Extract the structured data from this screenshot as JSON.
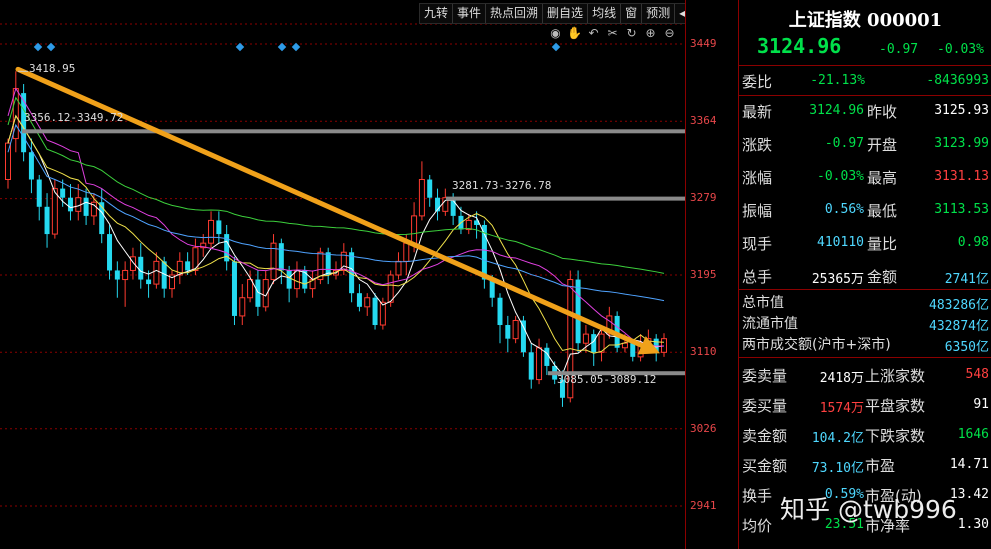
{
  "toolbar": {
    "items": [
      "九转",
      "事件",
      "热点回溯",
      "删自选",
      "均线",
      "窗",
      "预测"
    ],
    "back_icon": "chevron-left-icon"
  },
  "controls": [
    "eye-icon",
    "hand-icon",
    "undo-icon",
    "scissors-icon",
    "refresh-icon",
    "zoom-in-icon",
    "zoom-out-icon"
  ],
  "y_ticks": [
    "3449",
    "3364",
    "3279",
    "3195",
    "3110",
    "3026",
    "2941"
  ],
  "annotations": {
    "high": "3418.95",
    "resist1": "3356.12-3349.72",
    "resist2": "3281.73-3276.78",
    "support": "3085.05-3089.12"
  },
  "chart_data": {
    "type": "candlestick",
    "y_ticks": [
      3449,
      3364,
      3279,
      3195,
      3110,
      3026,
      2941
    ],
    "ylim": [
      2910,
      3480
    ],
    "levels": [
      {
        "label": "3356.12-3349.72",
        "value": 3353
      },
      {
        "label": "3281.73-3276.78",
        "value": 3279
      },
      {
        "label": "3085.05-3089.12",
        "value": 3087
      }
    ],
    "marked_high": 3418.95,
    "trend_line": {
      "from": 3418.95,
      "to": 3110
    },
    "candles": [
      [
        3300,
        3340,
        3290,
        3345
      ],
      [
        3345,
        3400,
        3330,
        3419
      ],
      [
        3395,
        3330,
        3320,
        3405
      ],
      [
        3330,
        3300,
        3285,
        3345
      ],
      [
        3300,
        3270,
        3255,
        3305
      ],
      [
        3270,
        3240,
        3225,
        3285
      ],
      [
        3240,
        3290,
        3235,
        3300
      ],
      [
        3290,
        3280,
        3270,
        3300
      ],
      [
        3280,
        3265,
        3255,
        3295
      ],
      [
        3265,
        3280,
        3255,
        3295
      ],
      [
        3280,
        3260,
        3250,
        3290
      ],
      [
        3260,
        3275,
        3250,
        3285
      ],
      [
        3275,
        3240,
        3230,
        3290
      ],
      [
        3240,
        3200,
        3190,
        3250
      ],
      [
        3200,
        3190,
        3170,
        3210
      ],
      [
        3190,
        3200,
        3160,
        3210
      ],
      [
        3200,
        3215,
        3190,
        3225
      ],
      [
        3215,
        3190,
        3180,
        3230
      ],
      [
        3190,
        3185,
        3170,
        3200
      ],
      [
        3185,
        3210,
        3180,
        3220
      ],
      [
        3210,
        3180,
        3170,
        3215
      ],
      [
        3180,
        3195,
        3170,
        3200
      ],
      [
        3195,
        3210,
        3185,
        3220
      ],
      [
        3210,
        3200,
        3195,
        3220
      ],
      [
        3200,
        3225,
        3195,
        3235
      ],
      [
        3225,
        3230,
        3215,
        3240
      ],
      [
        3230,
        3255,
        3225,
        3265
      ],
      [
        3255,
        3240,
        3230,
        3265
      ],
      [
        3240,
        3210,
        3200,
        3250
      ],
      [
        3210,
        3150,
        3140,
        3215
      ],
      [
        3150,
        3170,
        3140,
        3185
      ],
      [
        3170,
        3190,
        3165,
        3200
      ],
      [
        3190,
        3160,
        3150,
        3200
      ],
      [
        3160,
        3190,
        3155,
        3200
      ],
      [
        3190,
        3230,
        3185,
        3240
      ],
      [
        3230,
        3200,
        3185,
        3235
      ],
      [
        3200,
        3180,
        3165,
        3205
      ],
      [
        3180,
        3200,
        3170,
        3210
      ],
      [
        3200,
        3180,
        3175,
        3205
      ],
      [
        3180,
        3190,
        3170,
        3200
      ],
      [
        3190,
        3220,
        3185,
        3225
      ],
      [
        3220,
        3195,
        3185,
        3225
      ],
      [
        3195,
        3200,
        3190,
        3210
      ],
      [
        3200,
        3220,
        3195,
        3230
      ],
      [
        3220,
        3175,
        3165,
        3225
      ],
      [
        3175,
        3160,
        3155,
        3185
      ],
      [
        3160,
        3170,
        3150,
        3175
      ],
      [
        3170,
        3140,
        3135,
        3175
      ],
      [
        3140,
        3165,
        3135,
        3170
      ],
      [
        3165,
        3195,
        3160,
        3200
      ],
      [
        3195,
        3210,
        3190,
        3220
      ],
      [
        3210,
        3230,
        3195,
        3240
      ],
      [
        3230,
        3260,
        3220,
        3275
      ],
      [
        3260,
        3300,
        3255,
        3320
      ],
      [
        3300,
        3280,
        3270,
        3305
      ],
      [
        3280,
        3265,
        3255,
        3290
      ],
      [
        3265,
        3280,
        3260,
        3290
      ],
      [
        3280,
        3260,
        3250,
        3285
      ],
      [
        3260,
        3245,
        3240,
        3270
      ],
      [
        3245,
        3255,
        3240,
        3262
      ],
      [
        3255,
        3250,
        3235,
        3265
      ],
      [
        3250,
        3190,
        3180,
        3255
      ],
      [
        3190,
        3170,
        3160,
        3195
      ],
      [
        3170,
        3140,
        3120,
        3175
      ],
      [
        3140,
        3125,
        3110,
        3150
      ],
      [
        3125,
        3145,
        3120,
        3150
      ],
      [
        3145,
        3110,
        3105,
        3150
      ],
      [
        3110,
        3080,
        3070,
        3120
      ],
      [
        3080,
        3115,
        3075,
        3125
      ],
      [
        3115,
        3095,
        3085,
        3120
      ],
      [
        3095,
        3080,
        3075,
        3100
      ],
      [
        3080,
        3060,
        3050,
        3090
      ],
      [
        3060,
        3190,
        3055,
        3200
      ],
      [
        3190,
        3120,
        3110,
        3200
      ],
      [
        3120,
        3130,
        3110,
        3140
      ],
      [
        3130,
        3110,
        3095,
        3135
      ],
      [
        3110,
        3130,
        3100,
        3140
      ],
      [
        3130,
        3150,
        3125,
        3160
      ],
      [
        3150,
        3115,
        3110,
        3155
      ],
      [
        3115,
        3120,
        3110,
        3130
      ],
      [
        3120,
        3105,
        3100,
        3125
      ],
      [
        3105,
        3120,
        3100,
        3130
      ],
      [
        3120,
        3125,
        3110,
        3135
      ],
      [
        3125,
        3110,
        3100,
        3130
      ],
      [
        3110,
        3125,
        3105,
        3131
      ]
    ]
  },
  "quote": {
    "title": "上证指数 000001",
    "price": "3124.96",
    "change": "-0.97",
    "pct": "-0.03%",
    "weibi_label": "委比",
    "weibi_pct": "-21.13%",
    "weibi_val": "-8436993",
    "rows": [
      {
        "l1": "最新",
        "v1": "3124.96",
        "l2": "昨收",
        "v2": "3125.93"
      },
      {
        "l1": "涨跌",
        "v1": "-0.97",
        "l2": "开盘",
        "v2": "3123.99"
      },
      {
        "l1": "涨幅",
        "v1": "-0.03%",
        "l2": "最高",
        "v2": "3131.13"
      },
      {
        "l1": "振幅",
        "v1": "0.56%",
        "l2": "最低",
        "v2": "3113.53"
      },
      {
        "l1": "现手",
        "v1": "410110",
        "l2": "量比",
        "v2": "0.98"
      },
      {
        "l1": "总手",
        "v1": "25365万",
        "l2": "金额",
        "v2": "2741亿"
      }
    ],
    "mcap": [
      {
        "l": "总市值",
        "v": "483286亿"
      },
      {
        "l": "流通市值",
        "v": "432874亿"
      },
      {
        "l": "两市成交额(沪市+深市)",
        "v": "6350亿"
      }
    ],
    "trade_rows": [
      {
        "l1": "委卖量",
        "v1": "2418万",
        "l2": "上涨家数",
        "v2": "548"
      },
      {
        "l1": "委买量",
        "v1": "1574万",
        "l2": "平盘家数",
        "v2": "91"
      },
      {
        "l1": "卖金额",
        "v1": "104.2亿",
        "l2": "下跌家数",
        "v2": "1646"
      },
      {
        "l1": "买金额",
        "v1": "73.10亿",
        "l2": "市盈",
        "v2": "14.71"
      },
      {
        "l1": "换手",
        "v1": "0.59%",
        "l2": "市盈(动)",
        "v2": "13.42"
      },
      {
        "l1": "均价",
        "v1": "23.51",
        "l2": "市净率",
        "v2": "1.30"
      }
    ]
  },
  "watermark": "知乎 @twb996",
  "colors": {
    "up": "#ff3b30",
    "down": "#25d9f0",
    "level": "#8a8a8a",
    "trend": "#f0a11a",
    "grid": "#8b0000"
  }
}
